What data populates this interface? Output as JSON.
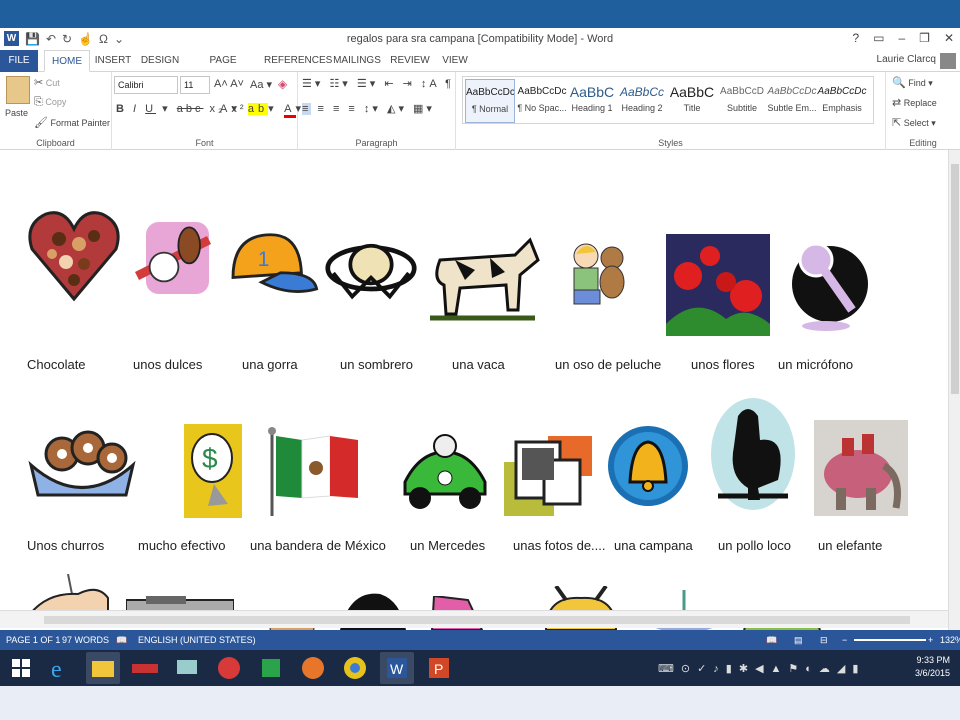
{
  "window": {
    "title": "regalos para sra campana [Compatibility Mode] - Word",
    "controls": [
      "?",
      "▭",
      "–",
      "❐",
      "✕"
    ],
    "user": "Laurie Clarcq"
  },
  "tabs": [
    "FILE",
    "HOME",
    "INSERT",
    "DESIGN",
    "PAGE LAYOUT",
    "REFERENCES",
    "MAILINGS",
    "REVIEW",
    "VIEW"
  ],
  "ribbon": {
    "clipboard": {
      "paste": "Paste",
      "cut": "Cut",
      "copy": "Copy",
      "format_painter": "Format Painter",
      "label": "Clipboard"
    },
    "font": {
      "name": "Calibri",
      "size": "11",
      "label": "Font"
    },
    "paragraph": {
      "label": "Paragraph"
    },
    "styles": {
      "label": "Styles",
      "items": [
        {
          "sample": "AaBbCcDc",
          "name": "¶ Normal"
        },
        {
          "sample": "AaBbCcDc",
          "name": "¶ No Spac..."
        },
        {
          "sample": "AaBbC",
          "name": "Heading 1"
        },
        {
          "sample": "AaBbCc",
          "name": "Heading 2"
        },
        {
          "sample": "AaBbC",
          "name": "Title"
        },
        {
          "sample": "AaBbCcD",
          "name": "Subtitle"
        },
        {
          "sample": "AaBbCcDc",
          "name": "Subtle Em..."
        },
        {
          "sample": "AaBbCcDc",
          "name": "Emphasis"
        }
      ]
    },
    "editing": {
      "find": "Find",
      "replace": "Replace",
      "select": "Select",
      "label": "Editing"
    }
  },
  "document": {
    "row1": [
      "Chocolate",
      "unos dulces",
      "una gorra",
      "un sombrero",
      "una vaca",
      "un oso de peluche",
      "unos flores",
      "un micrófono"
    ],
    "row2": [
      "Unos churros",
      "mucho efectivo",
      "una bandera de México",
      "un Mercedes",
      "unas fotos de....",
      "una campana",
      "un pollo loco",
      "un elefante"
    ]
  },
  "status": {
    "page": "PAGE 1 OF 1",
    "words": "97 WORDS",
    "language": "ENGLISH (UNITED STATES)",
    "zoom": "132%"
  },
  "clock": {
    "time": "9:33 PM",
    "date": "3/6/2015"
  },
  "colors": {
    "word_blue": "#2b579a",
    "taskbar": "#1a2a44",
    "slide_band": "#1f5f9e"
  }
}
